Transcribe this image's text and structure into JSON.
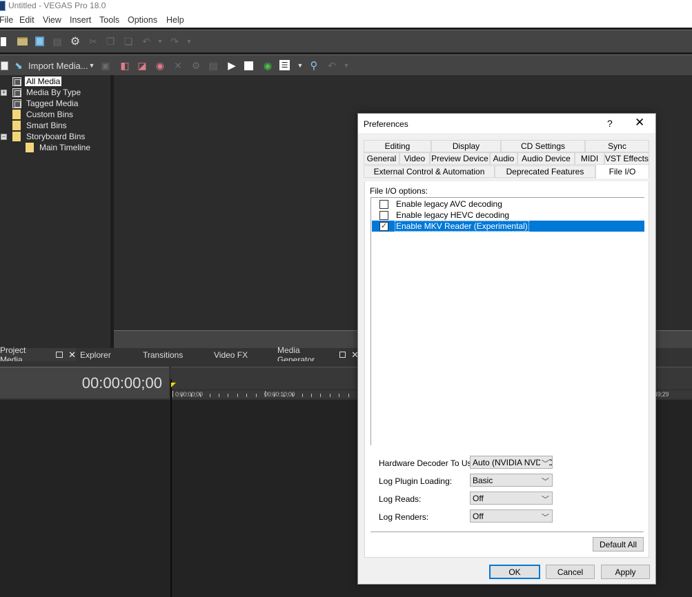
{
  "window": {
    "title": "Untitled - VEGAS Pro 18.0"
  },
  "menu": [
    "File",
    "Edit",
    "View",
    "Insert",
    "Tools",
    "Options",
    "Help"
  ],
  "toolbar_main": {
    "icons": [
      "new-project-icon",
      "open-folder-icon",
      "save-icon",
      "properties-icon",
      "settings-gear-icon",
      "cut-icon",
      "copy-icon",
      "paste-icon",
      "undo-icon",
      "undo-dropdown-icon",
      "redo-icon",
      "redo-dropdown-icon"
    ]
  },
  "toolbar_media": {
    "import_label": "Import Media...",
    "icons": [
      "view-icon",
      "import-media-icon",
      "import-dropdown-icon",
      "capture-icon",
      "add-bin-icon",
      "get-media-icon",
      "extract-audio-icon",
      "delete-icon",
      "media-fx-icon",
      "properties-icon",
      "play-icon",
      "stop-icon",
      "autopreview-icon",
      "views-icon",
      "views-dropdown-icon",
      "search-icon",
      "undo-icon",
      "undo-dropdown-icon"
    ]
  },
  "media_tree": [
    {
      "label": "All Media",
      "icon": "bin-icon",
      "selected": true
    },
    {
      "label": "Media By Type",
      "icon": "bin-icon",
      "expander": "+"
    },
    {
      "label": "Tagged Media",
      "icon": "bin-icon"
    },
    {
      "label": "Custom Bins",
      "icon": "folder-icon"
    },
    {
      "label": "Smart Bins",
      "icon": "folder-icon"
    },
    {
      "label": "Storyboard Bins",
      "icon": "folder-icon",
      "expander": "-"
    },
    {
      "label": "Main Timeline",
      "icon": "folder-icon",
      "indent": 1
    }
  ],
  "dock_tabs": [
    {
      "label": "Project Media",
      "active": true
    },
    {
      "label": "Explorer"
    },
    {
      "label": "Transitions"
    },
    {
      "label": "Video FX"
    },
    {
      "label": "Media Generator"
    }
  ],
  "timeline": {
    "timecode": "00:00:00;00",
    "ruler_labels": [
      "0:00:00;00",
      "00:00:10;00",
      "49;29"
    ],
    "playhead_color": "#e7e000"
  },
  "dialog": {
    "title": "Preferences",
    "help": "?",
    "close": "✕",
    "tabs_row1": [
      "Editing",
      "Display",
      "CD Settings",
      "Sync"
    ],
    "tabs_row2": [
      "General",
      "Video",
      "Preview Device",
      "Audio",
      "Audio Device",
      "MIDI",
      "VST Effects"
    ],
    "tabs_row3": [
      "External Control & Automation",
      "Deprecated Features",
      "File I/O"
    ],
    "active_tab": "File I/O",
    "options_label": "File I/O options:",
    "options": [
      {
        "label": "Enable legacy AVC decoding",
        "checked": false,
        "selected": false
      },
      {
        "label": "Enable legacy HEVC decoding",
        "checked": false,
        "selected": false
      },
      {
        "label": "Enable MKV Reader (Experimental)",
        "checked": true,
        "selected": true
      }
    ],
    "settings": [
      {
        "label": "Hardware Decoder To Use:",
        "value": "Auto (NVIDIA NVDEC"
      },
      {
        "label": "Log Plugin Loading:",
        "value": "Basic"
      },
      {
        "label": "Log Reads:",
        "value": "Off"
      },
      {
        "label": "Log Renders:",
        "value": "Off"
      }
    ],
    "default_all": "Default All",
    "ok": "OK",
    "cancel": "Cancel",
    "apply": "Apply",
    "accent": "#0078d7"
  }
}
